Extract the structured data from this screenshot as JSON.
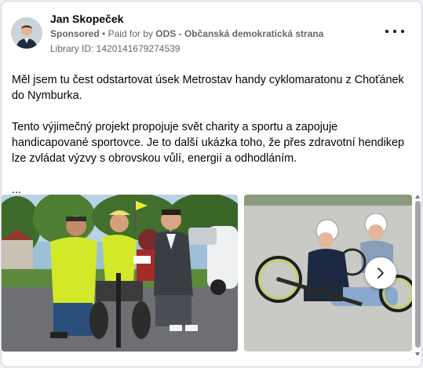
{
  "post": {
    "author": "Jan Skopeček",
    "sponsored_label": "Sponsored",
    "bullet": "•",
    "paid_for_label": "Paid for by",
    "payer": "ODS - Občanská demokratická strana",
    "library_id": "Library ID: 1420141679274539",
    "more_icon": "more-horizontal-icon",
    "paragraphs": [
      "Měl jsem tu čest odstartovat úsek Metrostav handy cyklomaratonu z Choťánek do Nymburka.",
      "Tento výjimečný projekt propojuje svět charity a sportu a zapojuje handicapované sportovce. Je to další ukázka toho, že přes zdravotní hendikep lze zvládat výzvy s obrovskou vůlí, energií a odhodláním."
    ],
    "ellipsis": "..."
  },
  "carousel": {
    "next_icon": "chevron-right-icon",
    "slides": [
      {
        "label": "group-photo-cyclists"
      },
      {
        "label": "handbike-riders-photo"
      }
    ]
  },
  "colors": {
    "text_primary": "#050505",
    "text_secondary": "#65676b",
    "vest": "#d4e82a",
    "jacket": "#1a2436"
  }
}
